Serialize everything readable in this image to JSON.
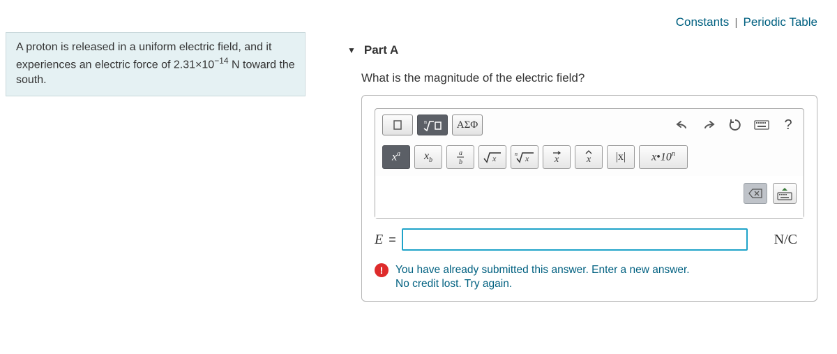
{
  "problem": {
    "line1": "A proton is released in a uniform electric field, and it experiences an electric force of",
    "value_prefix": "2.31×10",
    "exponent": "−14",
    "line2_suffix": " N toward the south."
  },
  "links": {
    "constants": "Constants",
    "periodic": "Periodic Table"
  },
  "part": {
    "title": "Part A",
    "question": "What is the magnitude of the electric field?",
    "greek_tab": "ΑΣΦ",
    "answer_var": "E",
    "equals": "=",
    "unit": "N/C"
  },
  "math_buttons": {
    "sup": {
      "base": "x",
      "exp": "a"
    },
    "sub": {
      "base": "x",
      "exp": "b"
    },
    "sci": {
      "base": "x",
      "dot": "•",
      "ten": "10",
      "exp": "n"
    },
    "abs": "|x|"
  },
  "feedback": {
    "line1": "You have already submitted this answer. Enter a new answer.",
    "line2": "No credit lost. Try again."
  },
  "help_q": "?"
}
